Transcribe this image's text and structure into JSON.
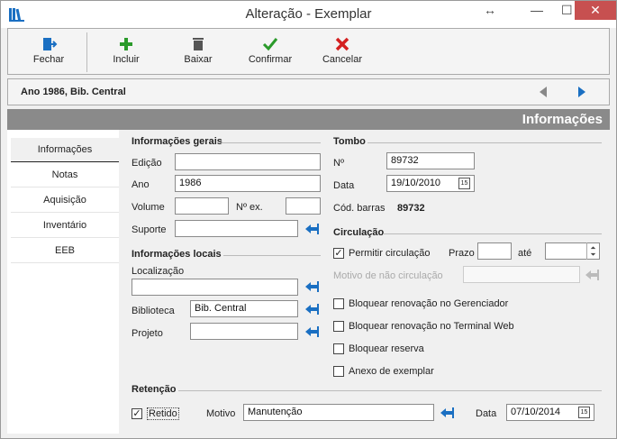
{
  "window": {
    "title": "Alteração - Exemplar"
  },
  "toolbar": {
    "fechar": "Fechar",
    "incluir": "Incluir",
    "baixar": "Baixar",
    "confirmar": "Confirmar",
    "cancelar": "Cancelar"
  },
  "record": {
    "label": "Ano 1986, Bib. Central"
  },
  "header": {
    "title": "Informações"
  },
  "tabs": [
    "Informações",
    "Notas",
    "Aquisição",
    "Inventário",
    "EEB"
  ],
  "info_gerais": {
    "heading": "Informações gerais",
    "edicao_label": "Edição",
    "edicao_value": "",
    "ano_label": "Ano",
    "ano_value": "1986",
    "volume_label": "Volume",
    "volume_value": "",
    "nex_label": "Nº ex.",
    "nex_value": "",
    "suporte_label": "Suporte",
    "suporte_value": ""
  },
  "info_locais": {
    "heading": "Informações locais",
    "localizacao_label": "Localização",
    "localizacao_value": "",
    "biblioteca_label": "Biblioteca",
    "biblioteca_value": "Bib. Central",
    "projeto_label": "Projeto",
    "projeto_value": ""
  },
  "tombo": {
    "heading": "Tombo",
    "n_label": "Nº",
    "n_value": "89732",
    "data_label": "Data",
    "data_value": "19/10/2010",
    "barras_label": "Cód. barras",
    "barras_value": "89732"
  },
  "circulacao": {
    "heading": "Circulação",
    "permitir_label": "Permitir circulação",
    "permitir_checked": true,
    "prazo_label": "Prazo",
    "prazo_value": "",
    "ate_label": "até",
    "ate_value": "",
    "motivo_label": "Motivo de não circulação",
    "motivo_value": "",
    "bloq_gerenciador": "Bloquear renovação no Gerenciador",
    "bloq_terminal": "Bloquear renovação no Terminal Web",
    "bloq_reserva": "Bloquear reserva",
    "anexo": "Anexo de exemplar"
  },
  "retencao": {
    "heading": "Retenção",
    "retido_label": "Retido",
    "retido_checked": true,
    "motivo_label": "Motivo",
    "motivo_value": "Manutenção",
    "data_label": "Data",
    "data_value": "07/10/2014"
  },
  "glyphs": {
    "check": "✓",
    "cal": "15",
    "arrows": "↔",
    "min": "—",
    "max": "☐",
    "close": "✕"
  }
}
